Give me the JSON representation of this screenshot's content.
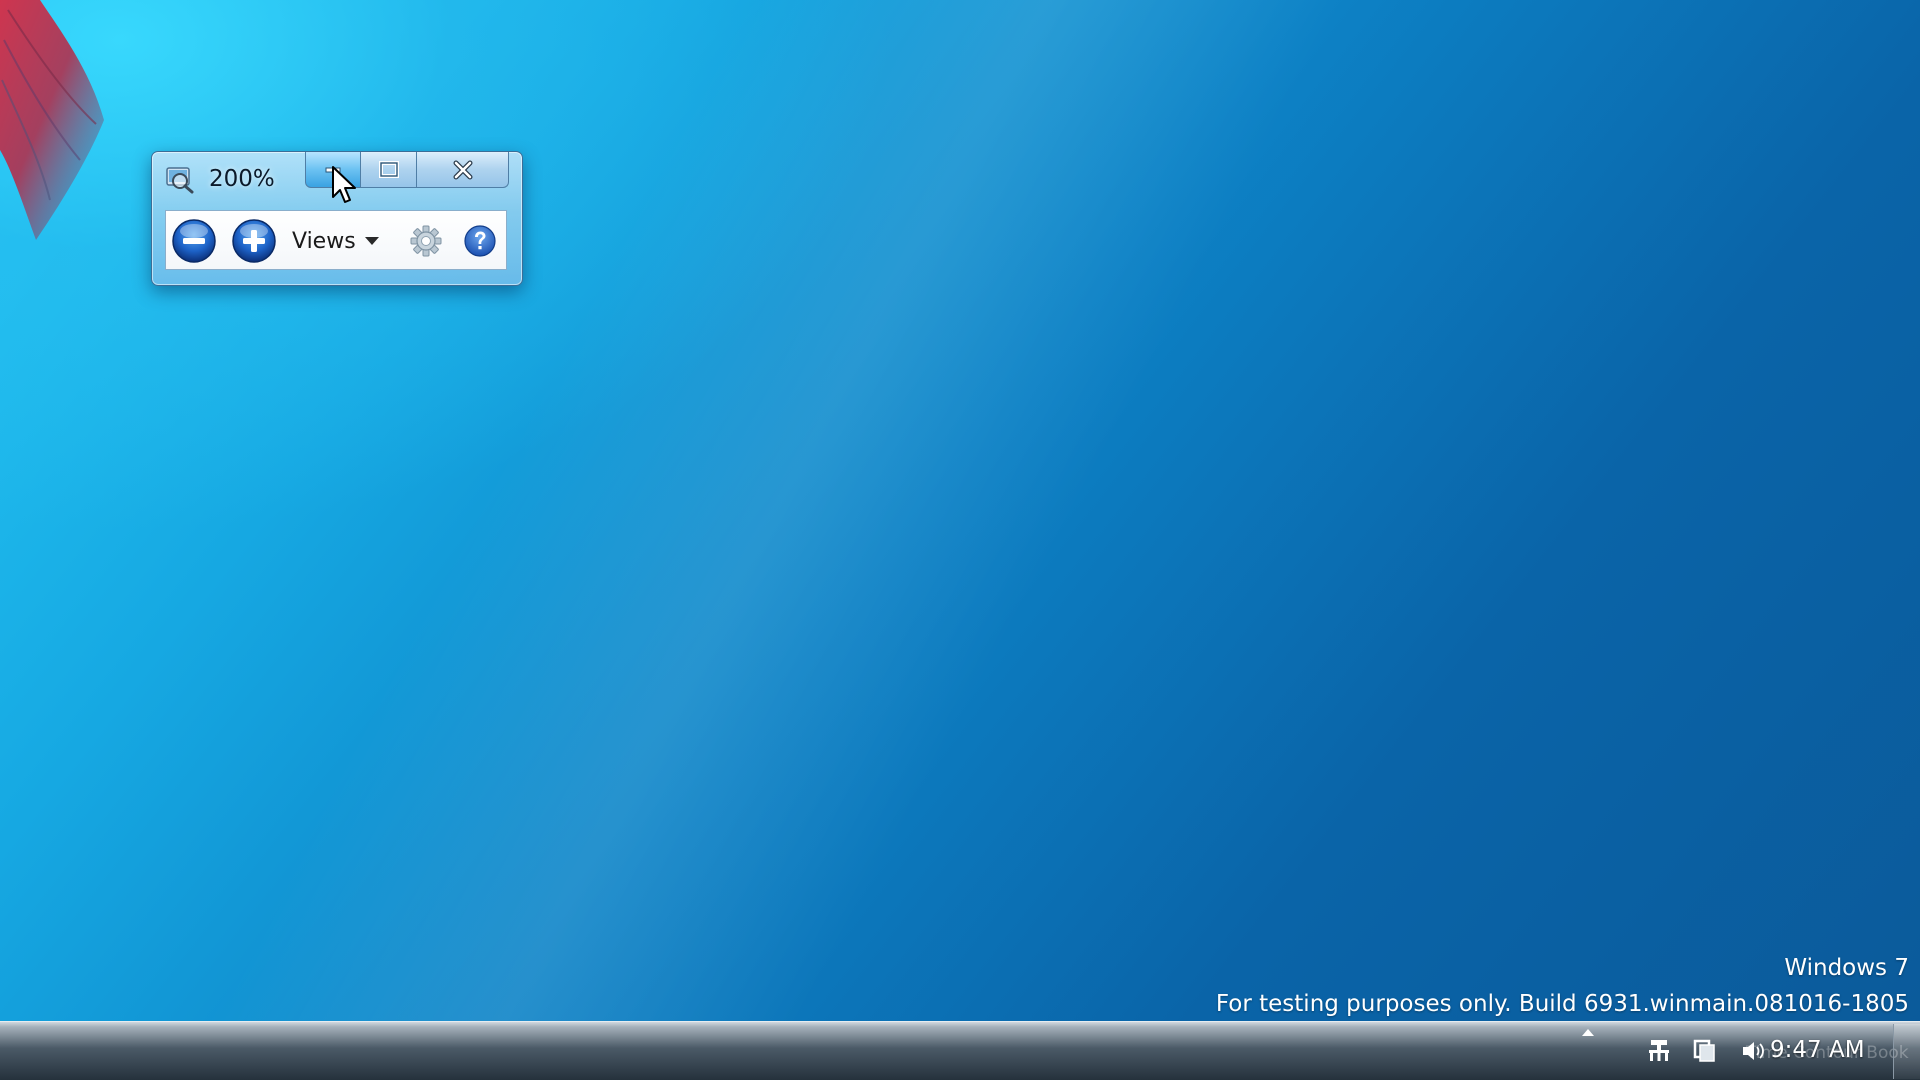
{
  "magnifier": {
    "zoom_level": "200%",
    "views_label": "Views",
    "icons": {
      "app": "magnifier-icon",
      "minimize": "minimize-icon",
      "maximize": "maximize-icon",
      "close": "close-icon",
      "zoom_out": "minus-icon",
      "zoom_in": "plus-icon",
      "options": "gear-icon",
      "help": "question-icon"
    }
  },
  "watermark": {
    "line1": "Windows 7",
    "line2": "For testing purposes only. Build 6931.winmain.081016-1805"
  },
  "taskbar": {
    "clock": "9:47 AM",
    "tray_ghost_text": "Time Contour Book",
    "icons": {
      "overflow": "up-arrow-icon",
      "network": "network-icon",
      "action_center": "flag-icon",
      "volume": "speaker-icon"
    }
  },
  "colors": {
    "desktop_light": "#25c8f5",
    "desktop_dark": "#0b5a9a",
    "accent_blue": "#1d62c7"
  }
}
